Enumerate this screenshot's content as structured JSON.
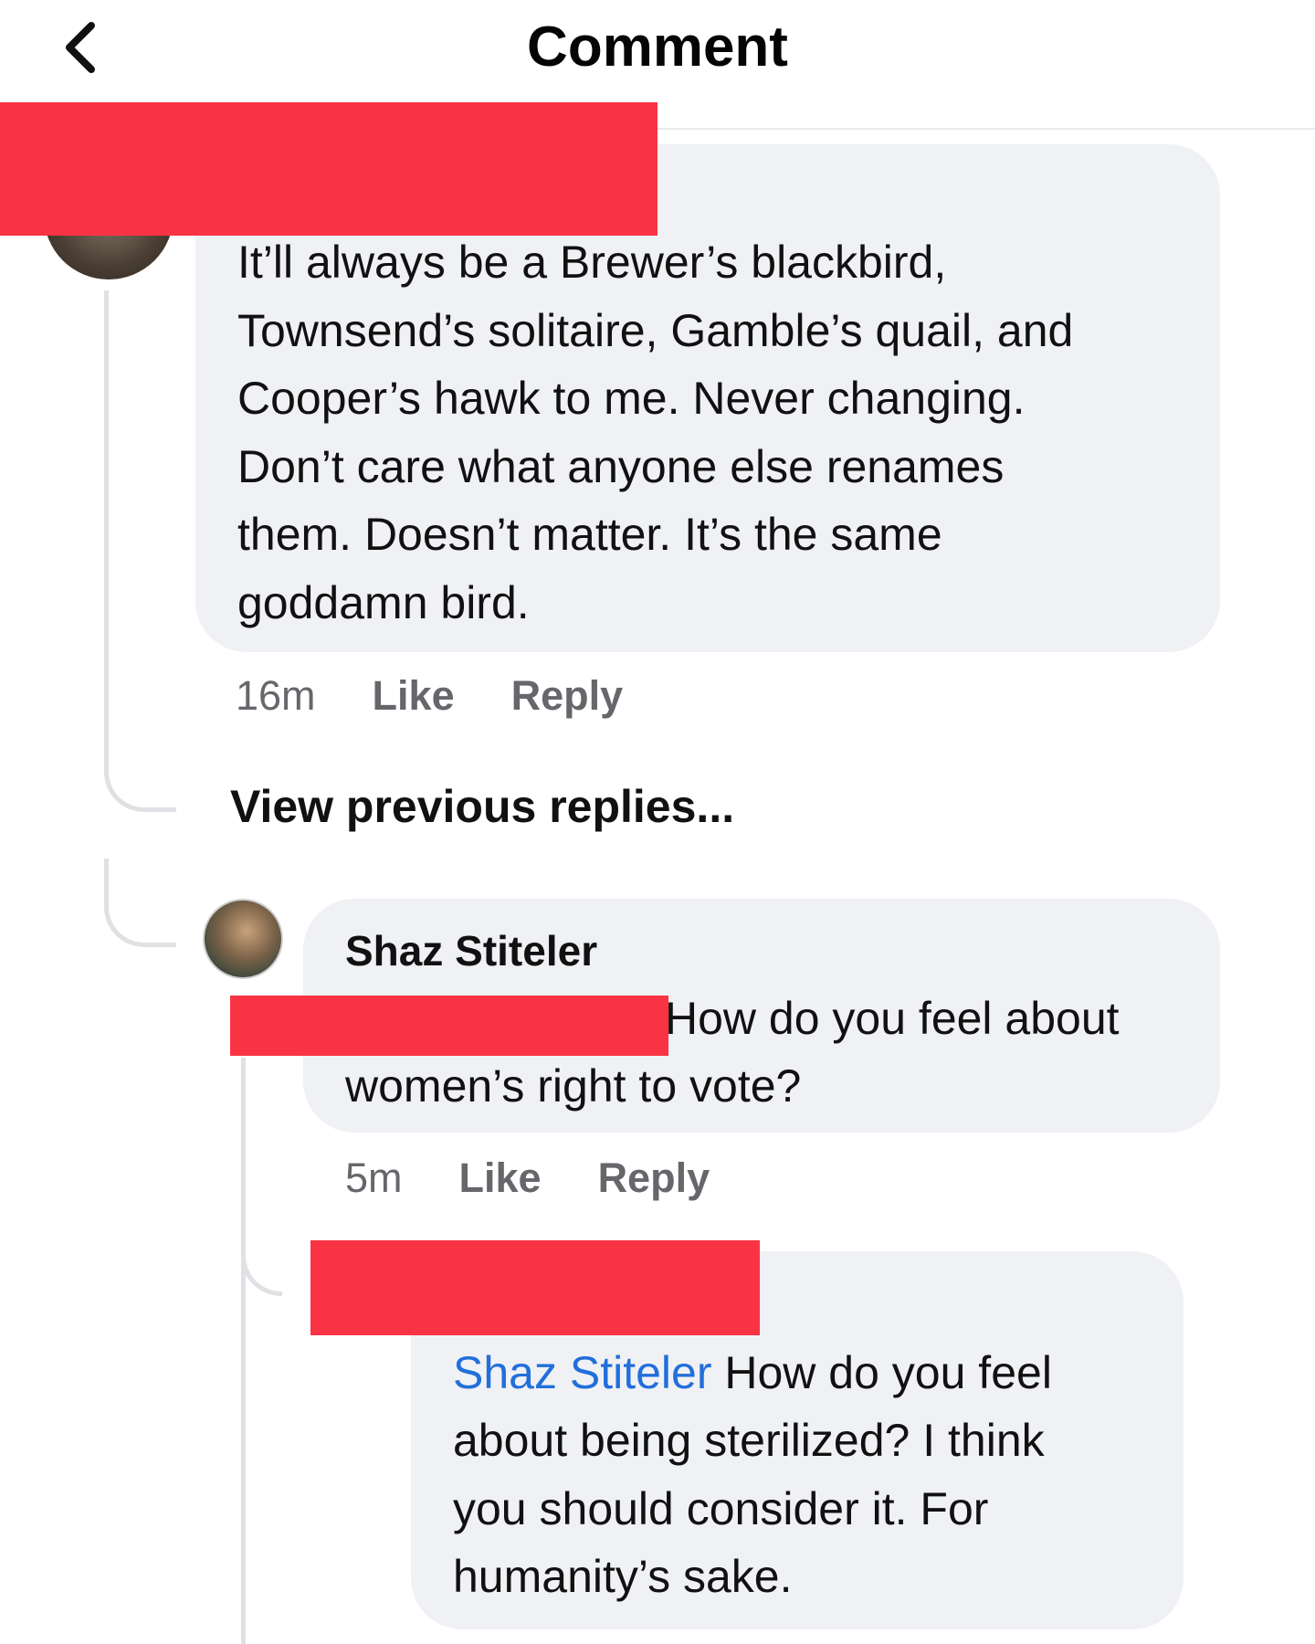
{
  "header": {
    "title": "Comment",
    "back_icon": "chevron-left-icon"
  },
  "comments": [
    {
      "text": "It’ll always be a Brewer’s blackbird, Townsend’s solitaire, Gamble’s quail, and Cooper’s hawk to me.  Never changing.  Don’t care what anyone else renames them.  Doesn’t matter.  It’s the same goddamn bird.",
      "lines": [
        "It’ll always be a Brewer’s blackbird,",
        "Townsend’s solitaire, Gamble’s quail, and",
        "Cooper’s hawk to me.  Never changing.",
        "Don’t care what anyone else renames",
        "them.  Doesn’t matter.  It’s the same",
        "goddamn bird."
      ],
      "time": "16m",
      "like_label": "Like",
      "reply_label": "Reply"
    }
  ],
  "view_previous": "View previous replies...",
  "replies": [
    {
      "author": "Shaz Stiteler",
      "line1": "How do you feel about",
      "line2": "women’s right to vote?",
      "time": "5m",
      "like_label": "Like",
      "reply_label": "Reply"
    },
    {
      "mention": "Shaz Stiteler",
      "line1_rest": " How do you feel",
      "lines": [
        "about being sterilized?  I think",
        "you should consider it.  For",
        "humanity’s sake."
      ]
    }
  ],
  "colors": {
    "redaction": "#fa3344",
    "bubble": "#f0f1f4",
    "mention": "#216fdb",
    "meta": "#65676b"
  }
}
